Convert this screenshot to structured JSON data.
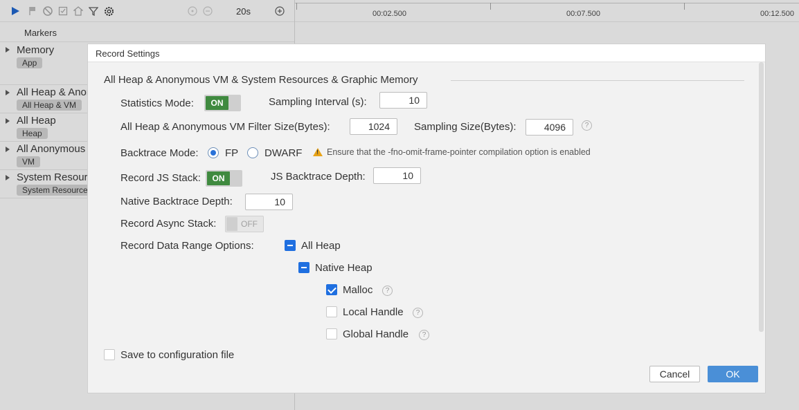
{
  "toolbar": {
    "icons": [
      "play-icon",
      "flag-icon",
      "stop-circle-icon",
      "capture-icon",
      "home-icon",
      "filter-icon",
      "settings-icon",
      "zoom-reset-icon",
      "zoom-out-icon",
      "zoom-in-icon"
    ],
    "time_range": "20s",
    "accent": "#1e5fbf"
  },
  "timeline": {
    "ticks": [
      "00:02.500",
      "00:07.500",
      "00:12.500"
    ]
  },
  "sidebar": {
    "markers_label": "Markers",
    "tracks": [
      {
        "title": "Memory",
        "tag": "App"
      },
      {
        "title": "All Heap & Anonymous VM",
        "tag": "All Heap & VM"
      },
      {
        "title": "All Heap",
        "tag": "Heap"
      },
      {
        "title": "All Anonymous VM",
        "tag": "VM"
      },
      {
        "title": "System Resources",
        "tag": "System Resources"
      }
    ]
  },
  "dialog": {
    "title": "Record Settings",
    "section_title": "All Heap & Anonymous VM & System Resources & Graphic Memory",
    "statistics_mode": {
      "label": "Statistics Mode:",
      "state": "ON"
    },
    "sampling_interval": {
      "label": "Sampling Interval (s):",
      "value": "10"
    },
    "filter_size": {
      "label": "All Heap & Anonymous VM Filter Size(Bytes):",
      "value": "1024"
    },
    "sampling_size": {
      "label": "Sampling Size(Bytes):",
      "value": "4096",
      "help": "?"
    },
    "backtrace_mode": {
      "label": "Backtrace Mode:",
      "options": [
        "FP",
        "DWARF"
      ],
      "selected": "FP",
      "warning": "Ensure that the -fno-omit-frame-pointer compilation option is enabled"
    },
    "record_js_stack": {
      "label": "Record JS Stack:",
      "state": "ON"
    },
    "js_backtrace_depth": {
      "label": "JS Backtrace Depth:",
      "value": "10"
    },
    "native_backtrace_depth": {
      "label": "Native Backtrace Depth:",
      "value": "10"
    },
    "record_async_stack": {
      "label": "Record Async Stack:",
      "state": "OFF"
    },
    "data_range": {
      "label": "Record Data Range Options:",
      "all_heap": {
        "label": "All Heap",
        "state": "partial"
      },
      "native_heap": {
        "label": "Native Heap",
        "state": "partial"
      },
      "malloc": {
        "label": "Malloc",
        "state": "checked",
        "help": "?"
      },
      "local_handle": {
        "label": "Local Handle",
        "state": "unchecked",
        "help": "?"
      },
      "global_handle": {
        "label": "Global Handle",
        "state": "unchecked",
        "help": "?"
      }
    },
    "save_config": {
      "label": "Save to configuration file",
      "state": "unchecked"
    },
    "cancel_label": "Cancel",
    "ok_label": "OK",
    "toggle_on_color": "#3f8a3f",
    "primary_color": "#4a8fd7",
    "checkbox_color": "#1f6fe0"
  }
}
